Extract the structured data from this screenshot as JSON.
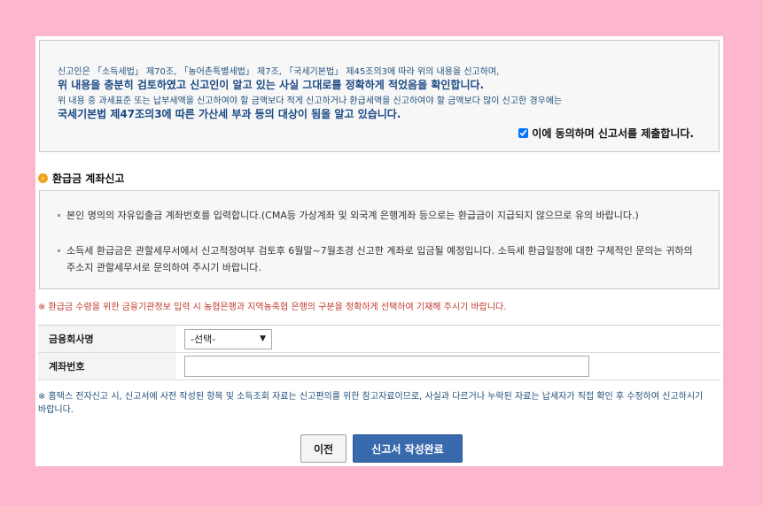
{
  "notice": {
    "line1": "신고인은 「소득세법」 제70조, 「농어촌특별세법」 제7조, 「국세기본법」 제45조의3에 따라 위의 내용을 신고하며,",
    "line2": "위 내용을 충분히 검토하였고 신고인이 알고 있는 사실 그대로를 정확하게 적었음을 확인합니다.",
    "line3": "위 내용 중 과세표준 또는 납부세액을 신고하여야 할 금액보다 적게 신고하거나 환급세액을 신고하여야 할 금액보다 많이 신고한 경우에는",
    "line4": "국세기본법 제47조의3에 따른 가산세 부과 등의 대상이 됨을 알고 있습니다.",
    "agree_label": "이에 동의하며 신고서를 제출합니다."
  },
  "section": {
    "title": "환급금 계좌신고",
    "items": [
      "본인 명의의 자유입출금 계좌번호를 입력합니다.(CMA등 가상계좌 및 외국계 은행계좌 등으로는 환급금이 지급되지 않으므로 유의 바랍니다.)",
      "소득세 환급금은 관할세무서에서 신고적정여부 검토후 6월말~7월초경 신고한 계좌로 입금될 예정입니다. 소득세 환급일정에 대한 구체적인 문의는 귀하의 주소지 관할세무서로 문의하여 주시기 바랍니다."
    ]
  },
  "warning": "※ 환급금 수령을 위한 금융기관정보 입력 시 농협은행과 지역농축협 은행의 구분을 정확하게 선택하여 기재해 주시기 바랍니다.",
  "form": {
    "bank_label": "금융회사명",
    "bank_selected": "-선택-",
    "account_label": "계좌번호",
    "account_value": ""
  },
  "note": "※ 홈택스 전자신고 시, 신고서에 사전 작성된 항목 및 소득조회 자료는 신고편의를 위한 참고자료이므로, 사실과 다르거나 누락된 자료는 납세자가 직접 확인 후 수정하여 신고하시기 바랍니다.",
  "buttons": {
    "prev": "이전",
    "complete": "신고서 작성완료"
  },
  "colors": {
    "background": "#fcb7cf",
    "primary_button": "#3a6aae",
    "warning": "#c0392b"
  }
}
